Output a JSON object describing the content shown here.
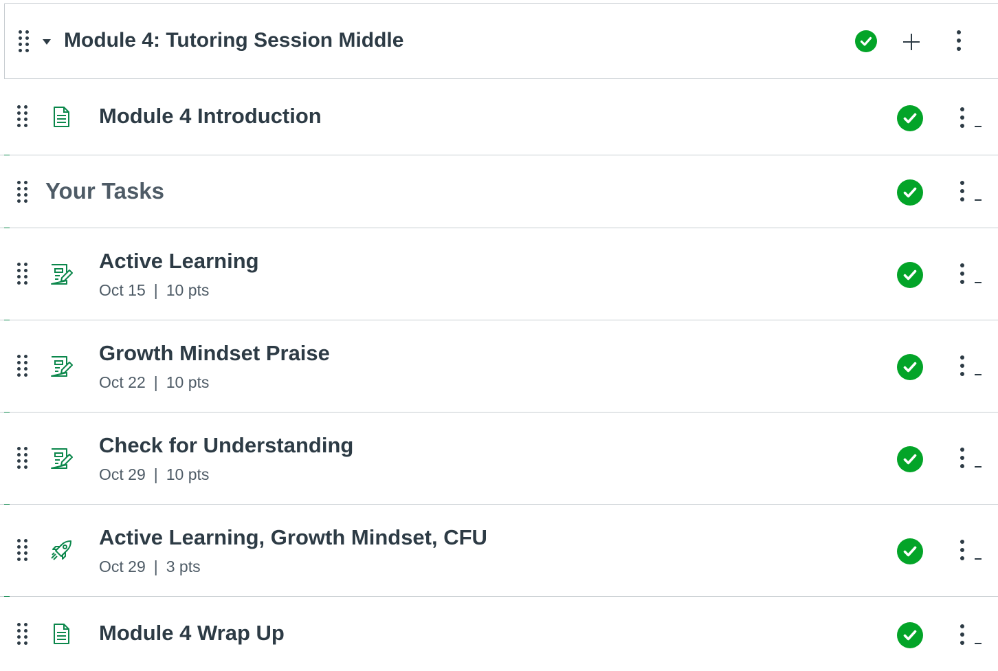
{
  "module": {
    "title": "Module 4: Tutoring Session Middle",
    "status": "published",
    "add_label": "+",
    "accent_color": "#0b874b",
    "published_color": "#03a428"
  },
  "items": [
    {
      "type_icon": "page-icon",
      "title": "Module 4 Introduction",
      "date": "",
      "sep": "",
      "points": "",
      "status": "published"
    },
    {
      "type_icon": "",
      "title": "Your Tasks",
      "date": "",
      "sep": "",
      "points": "",
      "status": "published"
    },
    {
      "type_icon": "assignment-icon",
      "title": "Active Learning",
      "date": "Oct 15",
      "sep": "|",
      "points": "10 pts",
      "status": "published"
    },
    {
      "type_icon": "assignment-icon",
      "title": "Growth Mindset Praise",
      "date": "Oct 22",
      "sep": "|",
      "points": "10 pts",
      "status": "published"
    },
    {
      "type_icon": "assignment-icon",
      "title": "Check for Understanding",
      "date": "Oct 29",
      "sep": "|",
      "points": "10 pts",
      "status": "published"
    },
    {
      "type_icon": "quiz-rocket-icon",
      "title": "Active Learning, Growth Mindset, CFU",
      "date": "Oct 29",
      "sep": "|",
      "points": "3 pts",
      "status": "published"
    },
    {
      "type_icon": "page-icon",
      "title": "Module 4 Wrap Up",
      "date": "",
      "sep": "",
      "points": "",
      "status": "published"
    }
  ]
}
